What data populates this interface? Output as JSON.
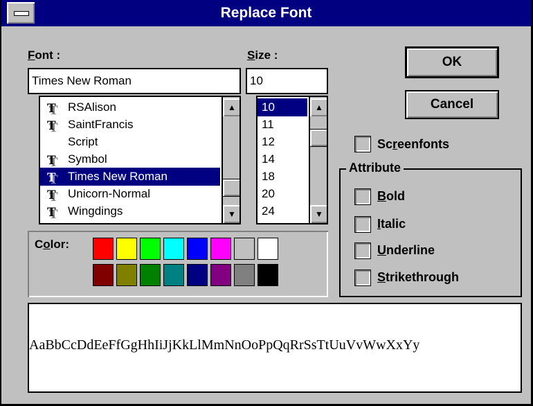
{
  "window": {
    "title": "Replace Font"
  },
  "font": {
    "label": "Font :",
    "value": "Times New Roman",
    "items": [
      {
        "name": "RSAlison",
        "truetype": true,
        "selected": false
      },
      {
        "name": "SaintFrancis",
        "truetype": true,
        "selected": false
      },
      {
        "name": "Script",
        "truetype": false,
        "selected": false
      },
      {
        "name": "Symbol",
        "truetype": true,
        "selected": false
      },
      {
        "name": "Times New Roman",
        "truetype": true,
        "selected": true
      },
      {
        "name": "Unicorn-Normal",
        "truetype": true,
        "selected": false
      },
      {
        "name": "Wingdings",
        "truetype": true,
        "selected": false
      }
    ]
  },
  "size": {
    "label": "Size :",
    "value": "10",
    "items": [
      {
        "name": "10",
        "selected": true
      },
      {
        "name": "11",
        "selected": false
      },
      {
        "name": "12",
        "selected": false
      },
      {
        "name": "14",
        "selected": false
      },
      {
        "name": "18",
        "selected": false
      },
      {
        "name": "20",
        "selected": false
      },
      {
        "name": "24",
        "selected": false
      }
    ]
  },
  "buttons": {
    "ok": "OK",
    "cancel": "Cancel"
  },
  "screenfonts": {
    "label": "Screenfonts",
    "checked": false
  },
  "attribute": {
    "title": "Attribute",
    "options": [
      {
        "label": "Bold",
        "checked": false
      },
      {
        "label": "Italic",
        "checked": false
      },
      {
        "label": "Underline",
        "checked": false
      },
      {
        "label": "Strikethrough",
        "checked": false
      }
    ]
  },
  "color": {
    "label": "Color:",
    "swatches": [
      "#ff0000",
      "#ffff00",
      "#00ff00",
      "#00ffff",
      "#0000ff",
      "#ff00ff",
      "#c0c0c0",
      "#ffffff",
      "#800000",
      "#808000",
      "#008000",
      "#008080",
      "#000080",
      "#800080",
      "#808080",
      "#000000"
    ],
    "selected_index": 15
  },
  "preview": {
    "sample": "AaBbCcDdEeFfGgHhIiJjKkLlMmNnOoPpQqRrSsTtUuVvWwXxYy"
  },
  "icons": {
    "truetype": "TT",
    "scroll_up": "▲",
    "scroll_down": "▼"
  }
}
